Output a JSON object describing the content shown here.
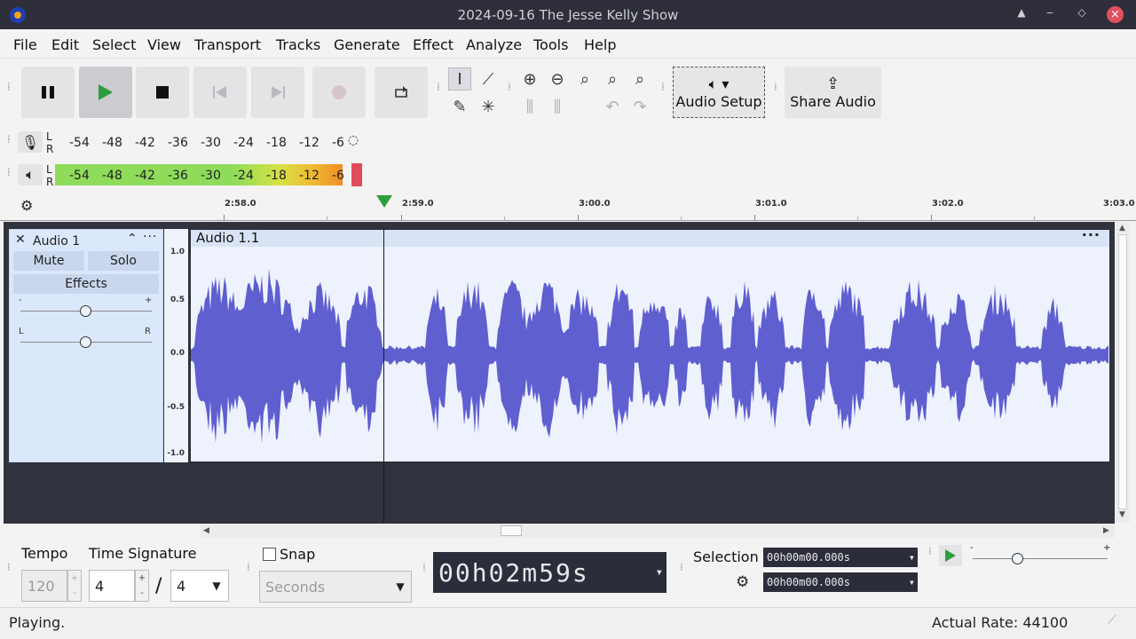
{
  "window": {
    "title": "2024-09-16 The Jesse Kelly Show"
  },
  "menu": [
    "File",
    "Edit",
    "Select",
    "View",
    "Transport",
    "Tracks",
    "Generate",
    "Effect",
    "Analyze",
    "Tools",
    "Help"
  ],
  "toolbar": {
    "audio_setup_label": "Audio Setup",
    "share_audio_label": "Share Audio"
  },
  "meters": {
    "l": "L",
    "r": "R",
    "ticks": [
      "-54",
      "-48",
      "-42",
      "-36",
      "-30",
      "-24",
      "-18",
      "-12",
      "-6"
    ]
  },
  "timeline": {
    "ticks": [
      "2:58.0",
      "2:59.0",
      "3:00.0",
      "3:01.0",
      "3:02.0",
      "3:03.0"
    ]
  },
  "track": {
    "name": "Audio 1",
    "mute_label": "Mute",
    "solo_label": "Solo",
    "effects_label": "Effects",
    "gain_minus": "-",
    "gain_plus": "+",
    "pan_left": "L",
    "pan_right": "R",
    "clip_name": "Audio 1.1",
    "vruler": [
      "1.0",
      "0.5",
      "0.0",
      "-0.5",
      "-1.0"
    ]
  },
  "bottom": {
    "tempo_label": "Tempo",
    "tempo_value": "120",
    "time_sig_label": "Time Signature",
    "time_sig_num": "4",
    "time_sig_slash": "/",
    "time_sig_den": "4",
    "snap_label": "Snap",
    "snap_unit": "Seconds",
    "big_time": "00h02m59s",
    "selection_label": "Selection",
    "sel_start": "00h00m00.000s",
    "sel_end": "00h00m00.000s"
  },
  "status": {
    "left": "Playing.",
    "right": "Actual Rate: 44100"
  },
  "colors": {
    "waveform": "#5f5fd0",
    "track_panel": "#dbe7fb",
    "titlebar": "#2e2f3a",
    "play_green": "#2e9e3c"
  }
}
